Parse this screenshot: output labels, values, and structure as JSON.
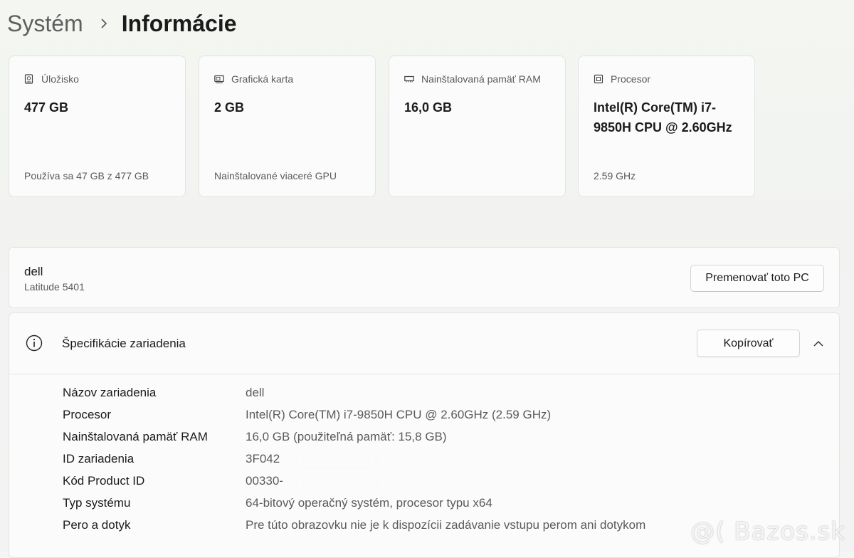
{
  "breadcrumb": {
    "parent": "Systém",
    "current": "Informácie"
  },
  "cards": [
    {
      "icon": "storage-icon",
      "label": "Úložisko",
      "value": "477 GB",
      "sub": "Používa sa 47 GB z 477 GB"
    },
    {
      "icon": "graphics-card-icon",
      "label": "Grafická karta",
      "value": "2 GB",
      "sub": "Nainštalované viaceré GPU"
    },
    {
      "icon": "ram-icon",
      "label": "Nainštalovaná pamäť RAM",
      "value": "16,0 GB",
      "sub": ""
    },
    {
      "icon": "processor-icon",
      "label": "Procesor",
      "value": "Intel(R) Core(TM) i7-9850H CPU @ 2.60GHz",
      "sub": "2.59 GHz"
    }
  ],
  "pc": {
    "name": "dell",
    "model": "Latitude 5401",
    "rename_label": "Premenovať toto PC"
  },
  "specs": {
    "title": "Špecifikácie zariadenia",
    "copy_label": "Kopírovať",
    "rows": [
      {
        "key": "Názov zariadenia",
        "value": "dell"
      },
      {
        "key": "Procesor",
        "value": "Intel(R) Core(TM) i7-9850H CPU @ 2.60GHz (2.59 GHz)"
      },
      {
        "key": "Nainštalovaná pamäť RAM",
        "value": "16,0 GB (použiteľná pamäť: 15,8 GB)"
      },
      {
        "key": "ID zariadenia",
        "value": "3F042"
      },
      {
        "key": "Kód Product ID",
        "value": "00330-"
      },
      {
        "key": "Typ systému",
        "value": "64-bitový operačný systém, procesor typu x64"
      },
      {
        "key": "Pero a dotyk",
        "value": "Pre túto obrazovku nie je k dispozícii zadávanie vstupu perom ani dotykom"
      }
    ]
  },
  "watermark": "@( Bazos.sk"
}
